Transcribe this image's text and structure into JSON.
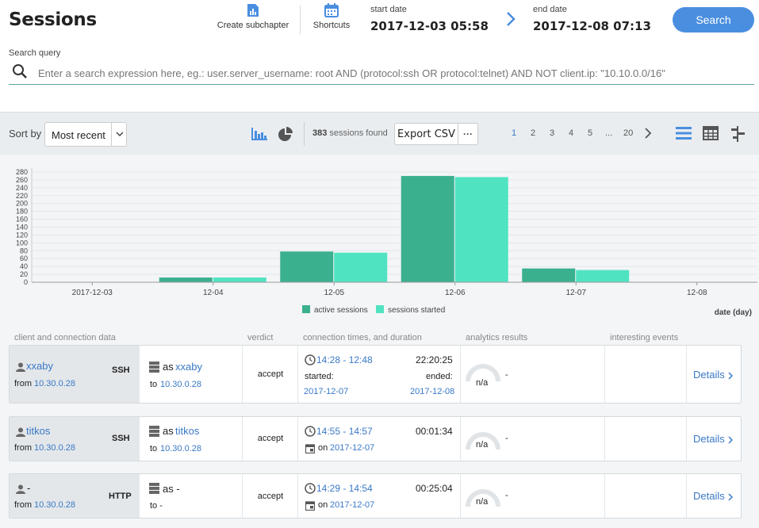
{
  "header": {
    "title": "Sessions",
    "create_subchapter": "Create subchapter",
    "shortcuts": "Shortcuts",
    "start_label": "start date",
    "start_value": "2017-12-03 05:58",
    "end_label": "end date",
    "end_value": "2017-12-08 07:13",
    "search_button": "Search",
    "query_label": "Search query",
    "query_placeholder": "Enter a search expression here, eg.: user.server_username: root AND (protocol:ssh OR protocol:telnet) AND NOT client.ip: \"10.10.0.0/16\""
  },
  "toolbar": {
    "sort_label": "Sort by",
    "sort_value": "Most recent",
    "sessions_count": "383",
    "sessions_suffix": "sessions found",
    "export_label": "Export CSV",
    "export_more": "···",
    "pages": [
      "1",
      "2",
      "3",
      "4",
      "5",
      "...",
      "20"
    ],
    "current_page": "1"
  },
  "chart_data": {
    "type": "bar",
    "categories": [
      "2017-12-03",
      "12-04",
      "12-05",
      "12-06",
      "12-07",
      "12-08"
    ],
    "series": [
      {
        "name": "active sessions",
        "color": "#3bb08f",
        "values": [
          0,
          12,
          78,
          270,
          35,
          0
        ]
      },
      {
        "name": "sessions started",
        "color": "#50e3c2",
        "values": [
          0,
          12,
          75,
          267,
          31,
          0
        ]
      }
    ],
    "yticks": [
      0,
      20,
      40,
      60,
      80,
      100,
      120,
      140,
      160,
      180,
      200,
      220,
      240,
      260,
      280
    ],
    "ylim": [
      0,
      290
    ],
    "xlabel": "date (day)",
    "ylabel": "",
    "grid": true,
    "legend_placement": "bottom-center"
  },
  "table": {
    "headers": {
      "client": "client and connection data",
      "verdict": "verdict",
      "times": "connection times, and duration",
      "analytics": "analytics results",
      "events": "interesting events"
    },
    "rows": [
      {
        "client_user": "xxaby",
        "client_from_label": "from",
        "client_ip": "10.30.0.28",
        "protocol": "SSH",
        "server_as_label": "as",
        "server_user": "xxaby",
        "server_to_label": "to",
        "server_ip": "10.30.0.28",
        "verdict": "accept",
        "time_range": "14:28 - 12:48",
        "duration": "22:20:25",
        "started_label": "started:",
        "started_date": "2017-12-07",
        "ended_label": "ended:",
        "ended_date": "2017-12-08",
        "analytics_gauge": "n/a",
        "analytics_value": "-",
        "details": "Details"
      },
      {
        "client_user": "titkos",
        "client_from_label": "from",
        "client_ip": "10.30.0.28",
        "protocol": "SSH",
        "server_as_label": "as",
        "server_user": "titkos",
        "server_to_label": "to",
        "server_ip": "10.30.0.28",
        "verdict": "accept",
        "time_range": "14:55 - 14:57",
        "duration": "00:01:34",
        "on_label": "on",
        "on_date": "2017-12-07",
        "analytics_gauge": "n/a",
        "analytics_value": "-",
        "details": "Details"
      },
      {
        "client_user": "-",
        "client_from_label": "from",
        "client_ip": "10.30.0.28",
        "protocol": "HTTP",
        "server_as_label": "as -",
        "server_user": "",
        "server_to_label": "to -",
        "server_ip": "",
        "verdict": "accept",
        "time_range": "14:29 - 14:54",
        "duration": "00:25:04",
        "on_label": "on",
        "on_date": "2017-12-07",
        "analytics_gauge": "n/a",
        "analytics_value": "-",
        "details": "Details"
      }
    ]
  },
  "colors": {
    "accent": "#4a8ee0",
    "link": "#3a78c7",
    "bar_dark": "#3bb08f",
    "bar_light": "#50e3c2"
  }
}
